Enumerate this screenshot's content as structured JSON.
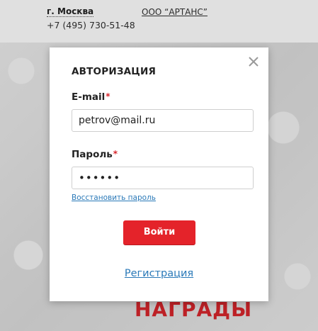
{
  "background": {
    "city": "г. Москва",
    "phone": "+7 (495) 730-51-48",
    "company": "ООО “АРТАНС”",
    "banner_text": "НАГРАДЫ"
  },
  "modal": {
    "title": "АВТОРИЗАЦИЯ",
    "email_label": "E-mail",
    "email_value": "petrov@mail.ru",
    "password_label": "Пароль",
    "password_value": "••••••",
    "required_mark": "*",
    "restore_link": "Восстановить пароль",
    "submit_button": "Войти",
    "register_link": "Регистрация"
  },
  "colors": {
    "accent_red": "#e4232a",
    "link_blue": "#2a79b8"
  },
  "icons": {
    "close": "close-icon"
  }
}
